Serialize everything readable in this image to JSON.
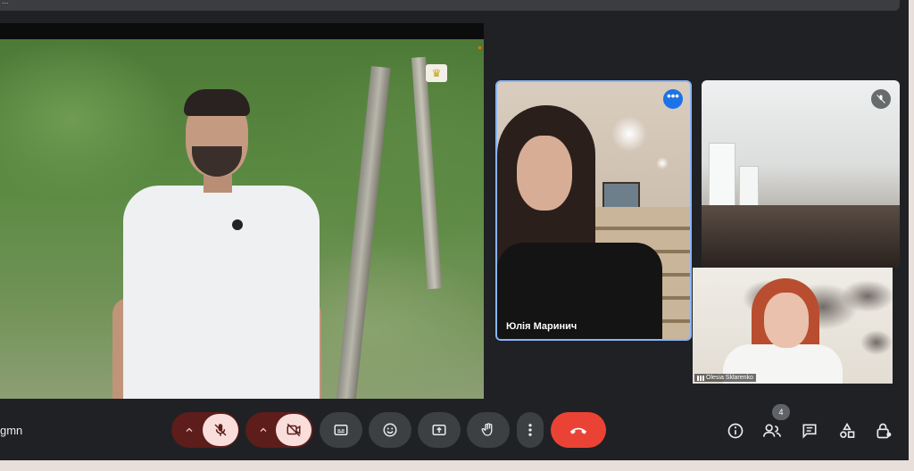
{
  "topbar": {
    "text": "..."
  },
  "participants": {
    "tile_1": {
      "name": "Юлія Маринич"
    },
    "tile_3": {
      "name": "Olesia Sklarenko"
    }
  },
  "footer": {
    "meeting_code": "gmn",
    "participants_count": "4"
  },
  "controls": [
    {
      "name": "mic-options",
      "icon": "chevron-up-icon"
    },
    {
      "name": "mic-toggle",
      "icon": "mic-off-icon",
      "state": "off"
    },
    {
      "name": "camera-options",
      "icon": "chevron-up-icon"
    },
    {
      "name": "camera-toggle",
      "icon": "camera-off-icon",
      "state": "off"
    },
    {
      "name": "captions",
      "icon": "captions-icon"
    },
    {
      "name": "reactions",
      "icon": "emoji-icon"
    },
    {
      "name": "present",
      "icon": "present-screen-icon"
    },
    {
      "name": "raise-hand",
      "icon": "hand-icon"
    },
    {
      "name": "more-options",
      "icon": "more-vert-icon"
    },
    {
      "name": "leave-call",
      "icon": "call-end-icon"
    }
  ],
  "side_controls": [
    {
      "name": "meeting-info",
      "icon": "info-icon"
    },
    {
      "name": "people",
      "icon": "people-icon"
    },
    {
      "name": "chat",
      "icon": "chat-icon"
    },
    {
      "name": "activities",
      "icon": "shapes-icon"
    },
    {
      "name": "host-controls",
      "icon": "lock-person-icon"
    }
  ],
  "colors": {
    "background": "#202124",
    "accent": "#8ab4f8",
    "hangup": "#ea4335",
    "muted_bg": "#5c1d1b",
    "muted_fg": "#f9dedc"
  }
}
